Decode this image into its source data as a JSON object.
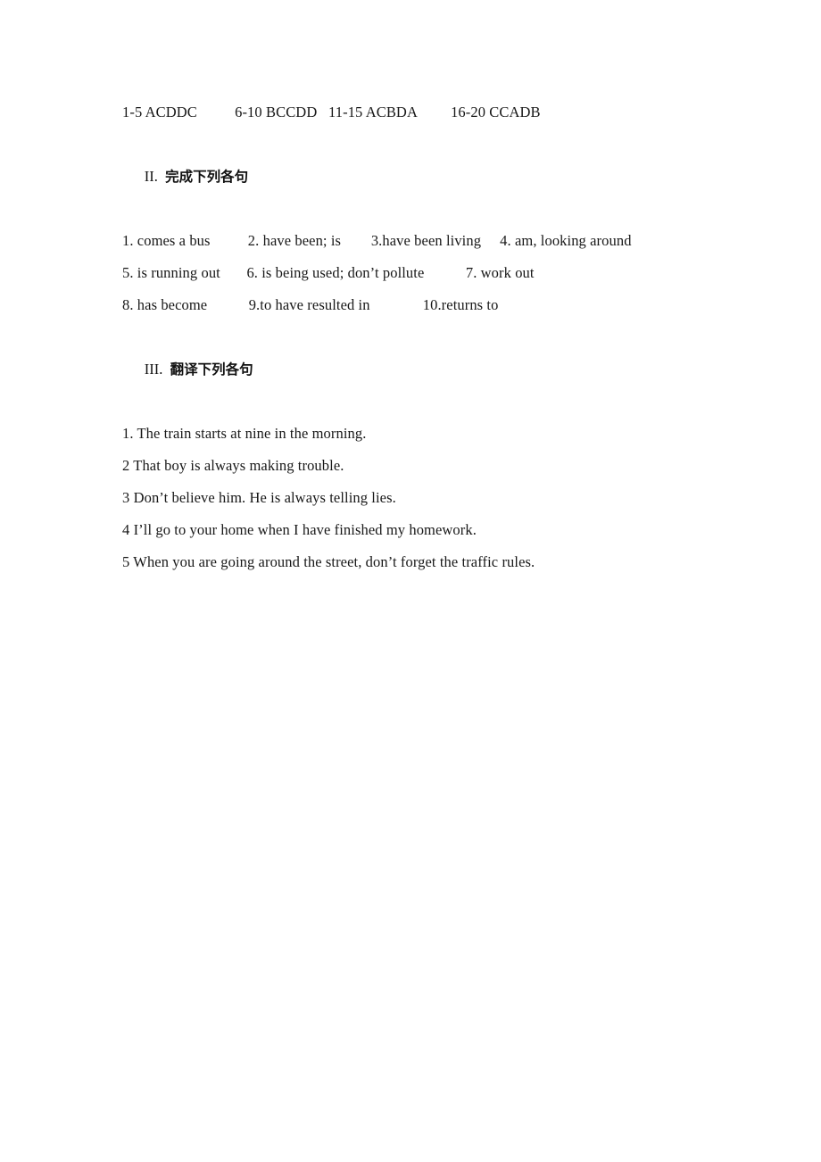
{
  "document": {
    "page_background": "#ffffff",
    "text_color": "#181818",
    "answer_key_line": {
      "groups": [
        "1-5 ACDDC",
        "6-10 BCCDD",
        "11-15 ACBDA",
        "16-20 CCADB"
      ],
      "full_text": "1-5 ACDDC          6-10 BCCDD   11-15 ACBDA         16-20 CCADB"
    },
    "sections": [
      {
        "number": "II.",
        "title_cn": "完成下列各句",
        "lines": [
          "1. comes a bus          2. have been; is        3.have been living     4. am, looking around",
          "5. is running out       6. is being used; don’t pollute           7. work out",
          "8. has become           9.to have resulted in              10.returns to"
        ],
        "answers": [
          {
            "number": "1.",
            "text": "comes a bus"
          },
          {
            "number": "2.",
            "text": "have been; is"
          },
          {
            "number": "3.",
            "text": "have been living"
          },
          {
            "number": "4.",
            "text": "am, looking around"
          },
          {
            "number": "5.",
            "text": "is running out"
          },
          {
            "number": "6.",
            "text": "is being used; don’t pollute"
          },
          {
            "number": "7.",
            "text": "work out"
          },
          {
            "number": "8.",
            "text": "has become"
          },
          {
            "number": "9.",
            "text": "to have resulted in"
          },
          {
            "number": "10.",
            "text": "returns to"
          }
        ]
      },
      {
        "number": "III.",
        "title_cn": "翻译下列各句",
        "lines": [
          "1. The train starts at nine in the morning.",
          "2 That boy is always making trouble.",
          "3 Don’t believe him. He is always telling lies.",
          "4 I’ll go to your home when I have finished my homework.",
          "5 When you are going around the street, don’t forget the traffic rules."
        ],
        "sentences": [
          {
            "number": "1.",
            "text": "The train starts at nine in the morning."
          },
          {
            "number": "2",
            "text": "That boy is always making trouble."
          },
          {
            "number": "3",
            "text": "Don’t believe him. He is always telling lies."
          },
          {
            "number": "4",
            "text": "I’ll go to your home when I have finished my homework."
          },
          {
            "number": "5",
            "text": "When you are going around the street, don’t forget the traffic rules."
          }
        ]
      }
    ]
  }
}
